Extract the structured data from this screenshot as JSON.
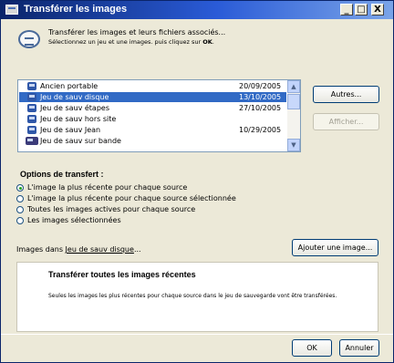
{
  "window": {
    "title": "Transférer les images",
    "controls": {
      "minimize": "_",
      "maximize": "□",
      "close": "X"
    }
  },
  "intro": {
    "icon": "transfer-icon",
    "line1": "Transférer les images et leurs fichiers associés...",
    "line2_prefix": "Sélectionnez un jeu et une images. puis cliquez sur ",
    "line2_bold": "OK",
    "line2_suffix": "."
  },
  "list": {
    "items": [
      {
        "label": "Ancien portable",
        "date": "20/09/2005",
        "icon": "disk-icon"
      },
      {
        "label": "Jeu de sauv disque",
        "date": "13/10/2005",
        "icon": "disk-icon",
        "selected": true
      },
      {
        "label": "Jeu de sauv étapes",
        "date": "27/10/2005",
        "icon": "disk-icon"
      },
      {
        "label": "Jeu de sauv hors site",
        "date": "",
        "icon": "disk-icon"
      },
      {
        "label": "Jeu de sauv Jean",
        "date": "10/29/2005",
        "icon": "disk-icon"
      },
      {
        "label": "Jeu de sauv sur bande",
        "date": "",
        "icon": "tape-icon"
      }
    ]
  },
  "buttons": {
    "autres": "Autres...",
    "afficher": "Afficher...",
    "ajouter": "Ajouter une image...",
    "ok": "OK",
    "annuler": "Annuler"
  },
  "options": {
    "title": "Options de transfert :",
    "items": [
      {
        "label": "L'image la plus récente pour chaque source",
        "checked": true
      },
      {
        "label": "L'image la plus récente pour chaque source sélectionnée",
        "checked": false
      },
      {
        "label": "Toutes les images actives pour chaque source",
        "checked": false
      },
      {
        "label": "Les images sélectionnées",
        "checked": false
      }
    ]
  },
  "images_line": {
    "prefix": "Images dans ",
    "link": "Jeu de sauv disque",
    "suffix": "..."
  },
  "description": {
    "title": "Transférer toutes les images récentes",
    "text": "Seules les images les plus récentes pour chaque source dans le jeu de sauvegarde vont être transférées."
  }
}
